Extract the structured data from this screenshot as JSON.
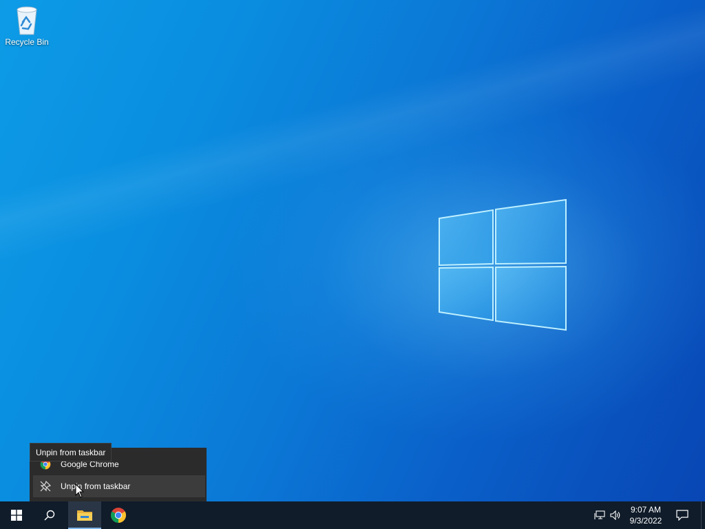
{
  "desktop": {
    "icons": [
      {
        "label": "Recycle Bin",
        "icon": "recycle-bin-icon"
      }
    ]
  },
  "jump_list": {
    "items": [
      {
        "label": "Google Chrome",
        "icon": "chrome-icon"
      },
      {
        "label": "Unpin from taskbar",
        "icon": "unpin-icon"
      }
    ]
  },
  "tooltip": {
    "text": "Unpin from taskbar"
  },
  "taskbar": {
    "buttons": [
      {
        "name": "start",
        "icon": "windows-logo-icon"
      },
      {
        "name": "search",
        "icon": "search-icon"
      },
      {
        "name": "file-explorer",
        "icon": "folder-icon"
      },
      {
        "name": "google-chrome",
        "icon": "chrome-icon"
      }
    ],
    "tray": {
      "icons": [
        "network-icon",
        "volume-icon"
      ],
      "time": "9:07 AM",
      "date": "9/3/2022",
      "notifications_icon": "notifications-icon"
    }
  },
  "colors": {
    "taskbar": "#101c2a",
    "menu": "#2b2b2b",
    "menu_highlight": "#3c3c3c",
    "desktop_accent": "#0a8ee0"
  }
}
